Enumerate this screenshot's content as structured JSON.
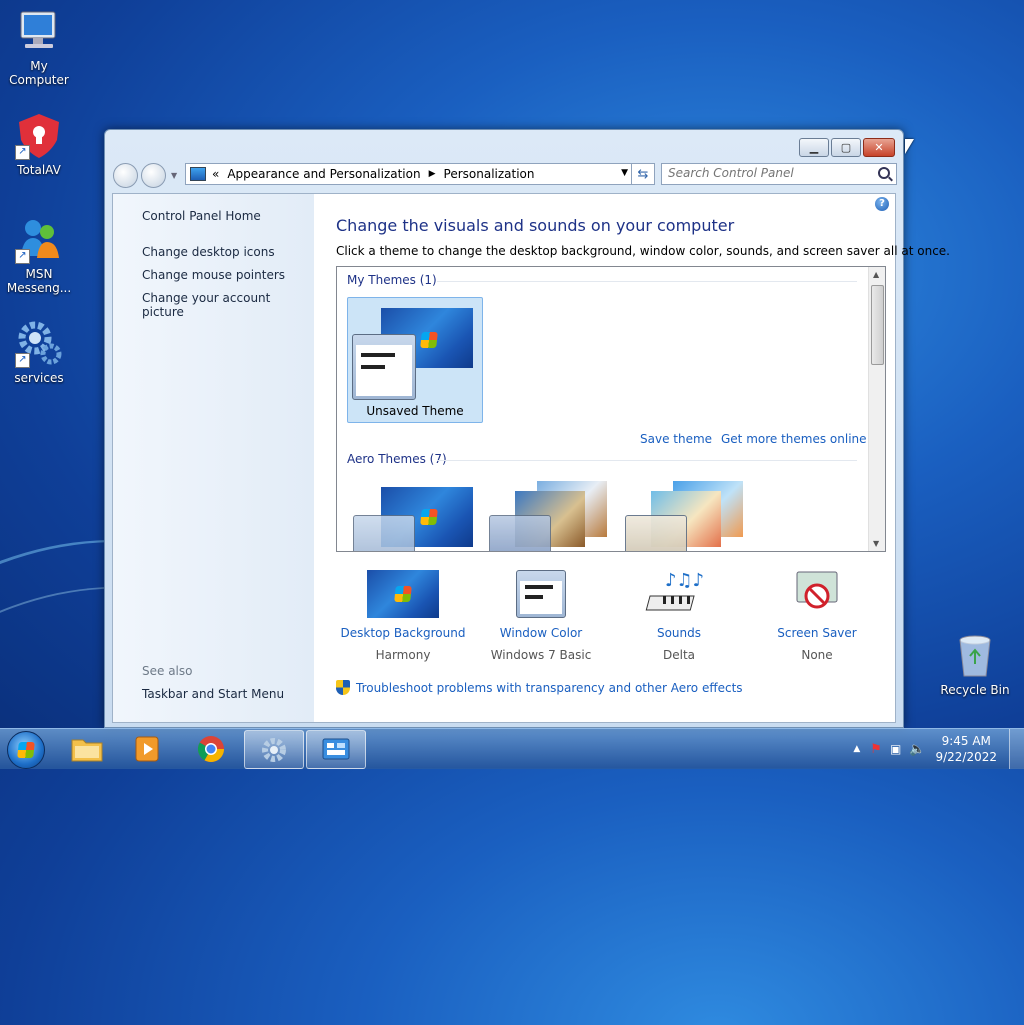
{
  "desktop": {
    "icons": [
      {
        "label": "My Computer",
        "icon": "computer-icon"
      },
      {
        "label": "TotalAV",
        "icon": "totalav-icon"
      },
      {
        "label": "MSN Messeng...",
        "icon": "msn-messenger-icon"
      },
      {
        "label": "services",
        "icon": "services-gear-icon"
      },
      {
        "label": "Recycle Bin",
        "icon": "recycle-bin-icon"
      }
    ]
  },
  "window": {
    "address": {
      "overflow": "«",
      "crumbs": [
        "Appearance and Personalization",
        "Personalization"
      ]
    },
    "search": {
      "placeholder": "Search Control Panel"
    },
    "left_pane": {
      "links": [
        "Control Panel Home",
        "Change desktop icons",
        "Change mouse pointers",
        "Change your account picture"
      ],
      "see_also_heading": "See also",
      "see_also_links": [
        "Taskbar and Start Menu"
      ]
    },
    "main": {
      "title": "Change the visuals and sounds on your computer",
      "subtitle": "Click a theme to change the desktop background, window color, sounds, and screen saver all at once.",
      "my_themes_heading": "My Themes (1)",
      "selected_theme": "Unsaved Theme",
      "save_theme": "Save theme",
      "get_more": "Get more themes online",
      "aero_heading": "Aero Themes (7)",
      "settings": [
        {
          "label": "Desktop Background",
          "value": "Harmony"
        },
        {
          "label": "Window Color",
          "value": "Windows 7 Basic"
        },
        {
          "label": "Sounds",
          "value": "Delta"
        },
        {
          "label": "Screen Saver",
          "value": "None"
        }
      ],
      "troubleshoot": "Troubleshoot problems with transparency and other Aero effects"
    }
  },
  "taskbar": {
    "time": "9:45 AM",
    "date": "9/22/2022"
  }
}
